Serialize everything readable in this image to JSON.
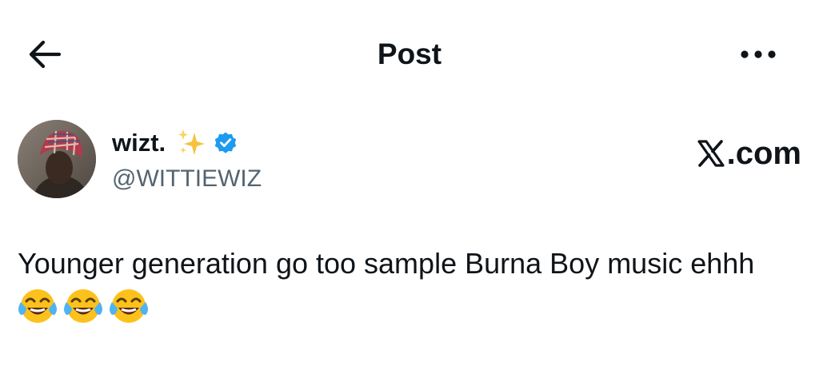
{
  "header": {
    "title": "Post",
    "back_icon": "arrow-left-icon",
    "more_icon": "more-horizontal-icon"
  },
  "author": {
    "display_name": "wizt.",
    "handle": "@WITTIEWIZ",
    "verified": true,
    "name_decoration_icon": "sparkles-icon",
    "verified_badge_color": "#1d9bf0"
  },
  "brand": {
    "logo_icon": "x-logo-icon",
    "label": ".com"
  },
  "post": {
    "text": "Younger generation go too sample Burna Boy music ehhh",
    "emojis": [
      "😂",
      "😂",
      "😂"
    ]
  },
  "colors": {
    "text_primary": "#0f1419",
    "text_secondary": "#536471",
    "background": "#ffffff",
    "accent": "#1d9bf0"
  }
}
